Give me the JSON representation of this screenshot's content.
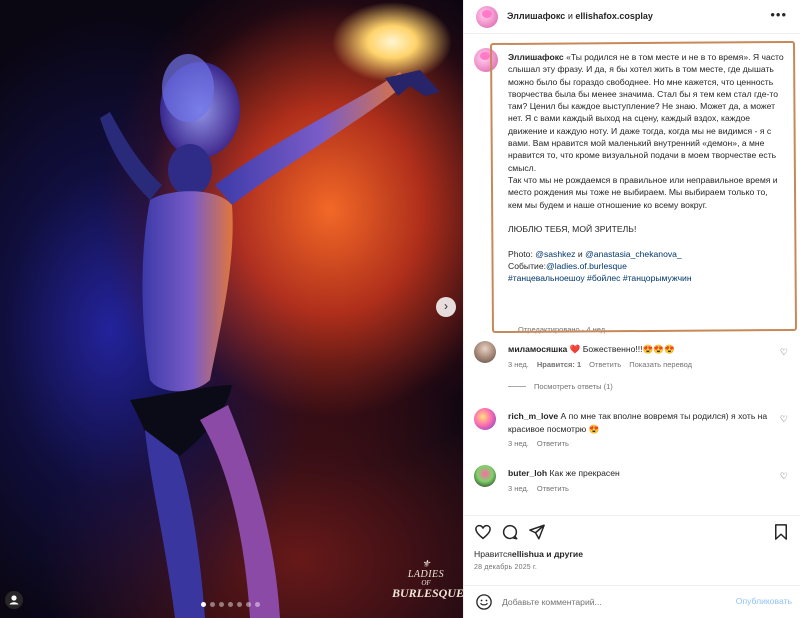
{
  "photo": {
    "watermark": {
      "line1": "LADIES",
      "line2": "OF",
      "line3": "BURLESQUE"
    },
    "next_arrow": "›",
    "carousel_dots": 7,
    "active_dot": 0
  },
  "header": {
    "author": "Эллишафокс",
    "and": "и",
    "coauthor": "ellishafox.cosplay",
    "more_icon": "•••"
  },
  "caption": {
    "author": "Эллишафокс",
    "text": "«Ты родился не в том месте и не в то время». Я часто слышал эту фразу. И да, я бы хотел жить в том месте, где дышать можно было бы гораздо свободнее. Но мне кажется, что ценность творчества была бы менее значима. Стал бы я тем кем стал где-то там? Ценил бы каждое выступление? Не знаю. Может да, а может нет. Я с вами каждый выход на сцену, каждый вздох, каждое движение и каждую ноту. И даже тогда, когда мы не видимся - я с вами. Вам нравится мой маленький внутренний «демон», а мне нравится то, что кроме визуальной подачи в моем творчестве есть смысл.\nТак что мы не рождаемся в правильное или неправильное время и место рождения мы тоже не выбираем. Мы выбираем только то, кем мы будем и наше отношение ко всему вокруг.\n\nЛЮБЛЮ ТЕБЯ, МОЙ ЗРИТЕЛЬ!\n\n",
    "photo_label": "Photo: ",
    "photo_user1": "@sashkez",
    "photo_and": " и ",
    "photo_user2": "@anastasia_chekanova_",
    "event_label": "Событие:",
    "event_user": "@ladies.of.burlesque",
    "hashtags": "#танцевальноешоу #бойлес #танцорымужчин",
    "edited": "Отредактировано · 4 нед."
  },
  "comments": [
    {
      "user": "миламосяшка",
      "text": " Божественно!!!😍😍😍",
      "heart": "❤️",
      "time": "3 нед.",
      "likes": "Нравится: 1",
      "reply": "Ответить",
      "translate": "Показать перевод",
      "view_replies": "Посмотреть ответы (1)"
    },
    {
      "user": "rich_m_love",
      "text": " А по мне так вполне вовремя ты родился) я хоть на красивое посмотрю 😍",
      "time": "3 нед.",
      "reply": "Ответить"
    },
    {
      "user": "buter_loh",
      "text": " Как же прекрасен",
      "time": "3 нед.",
      "reply": "Ответить"
    }
  ],
  "actions": {
    "likes_prefix": "Нравится",
    "likes_user": "ellishua",
    "likes_suffix": " и другие",
    "date": "28 декабрь 2025 г."
  },
  "add_comment": {
    "placeholder": "Добавьте комментарий...",
    "post_label": "Опубликовать"
  }
}
